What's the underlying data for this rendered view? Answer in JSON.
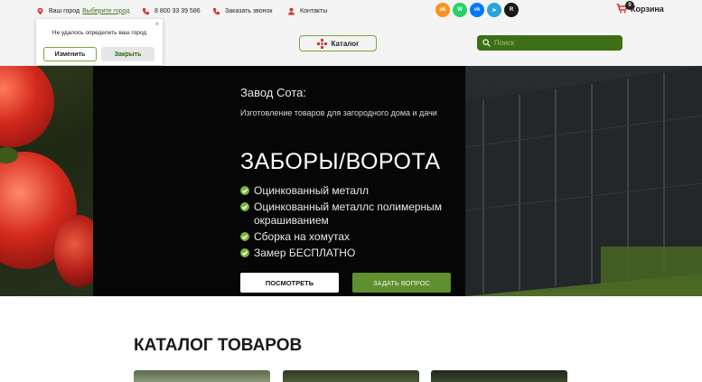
{
  "header": {
    "city_label": "Ваш город",
    "city_link": "Выберите город",
    "phone": "8 800 33 39 586",
    "callback": "Заказать звонок",
    "contacts": "Контакты",
    "socials": [
      {
        "icon": "odnoklassniki-icon",
        "glyph": "ok",
        "color": "#f7931e"
      },
      {
        "icon": "whatsapp-icon",
        "glyph": "W",
        "color": "#25d366"
      },
      {
        "icon": "vk-icon",
        "glyph": "vk",
        "color": "#0077ff"
      },
      {
        "icon": "telegram-icon",
        "glyph": "➤",
        "color": "#2aa3df"
      },
      {
        "icon": "rutube-icon",
        "glyph": "R",
        "color": "#1a1a1a"
      }
    ],
    "cart_label": "Корзина",
    "cart_count": "0",
    "catalog_label": "Каталог",
    "search_placeholder": "Поиск"
  },
  "popup": {
    "message": "Не удалось определить ваш город",
    "change": "Изменить",
    "close": "Закрыть",
    "close_glyph": "×"
  },
  "hero": {
    "company": "Завод Сота:",
    "description": "Изготовление товаров для загородного дома и дачи",
    "title": "ЗАБОРЫ/ВОРОТА",
    "features": [
      "Оцинкованный металл",
      "Оцинкованный металлс полимерным окрашиванием",
      "Сборка на хомутах",
      "Замер БЕСПЛАТНО"
    ],
    "view_button": "ПОСМОТРЕТЬ",
    "ask_button": "ЗАДАТЬ ВОПРОС"
  },
  "catalog": {
    "title": "КАТАЛОГ ТОВАРОВ"
  },
  "colors": {
    "accent_green": "#5f8f2e",
    "search_green": "#3c6f16",
    "header_bg": "#f4f4f4",
    "hero_bg": "#060606",
    "icon_red": "#d9342b"
  }
}
